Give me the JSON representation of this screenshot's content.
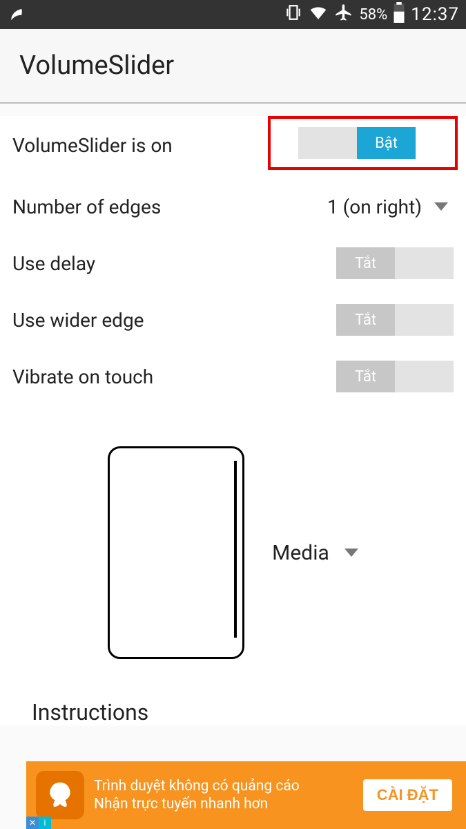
{
  "status": {
    "battery_pct": "58%",
    "time": "12:37"
  },
  "app": {
    "title": "VolumeSlider"
  },
  "settings": {
    "enabled": {
      "label": "VolumeSlider is on",
      "toggle_on_text": "Bật",
      "toggle_off_text": "",
      "state": "on"
    },
    "edges": {
      "label": "Number of edges",
      "value": "1 (on right)"
    },
    "delay": {
      "label": "Use delay",
      "toggle_on_text": "",
      "toggle_off_text": "Tắt",
      "state": "off"
    },
    "wider": {
      "label": "Use wider edge",
      "toggle_on_text": "",
      "toggle_off_text": "Tắt",
      "state": "off"
    },
    "vibrate": {
      "label": "Vibrate on touch",
      "toggle_on_text": "",
      "toggle_off_text": "Tắt",
      "state": "off"
    }
  },
  "preview": {
    "stream": "Media"
  },
  "instructions": {
    "heading": "Instructions"
  },
  "ad": {
    "line1": "Trình duyệt không có quảng cáo",
    "line2": "Nhận trực tuyến nhanh hơn",
    "cta": "CÀI ĐẶT"
  }
}
